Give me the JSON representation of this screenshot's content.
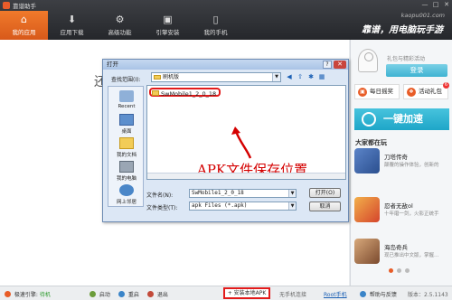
{
  "app": {
    "title": "靠谱助手"
  },
  "window_controls": [
    "—",
    "□",
    "✕"
  ],
  "nav": {
    "tabs": [
      {
        "label": "我的应用",
        "icon": "home-icon",
        "active": true
      },
      {
        "label": "应用下载",
        "icon": "download-icon",
        "active": false
      },
      {
        "label": "高级功能",
        "icon": "gears-icon",
        "active": false
      },
      {
        "label": "引擎安装",
        "icon": "engine-icon",
        "active": false
      },
      {
        "label": "我的手机",
        "icon": "phone-icon",
        "active": false
      }
    ],
    "brand_url": "kaopu001.com",
    "brand_slogan": "靠谱，用电脑玩手游"
  },
  "main": {
    "background_char": "还"
  },
  "side": {
    "hint": "礼包与精彩活动",
    "login_label": "登录",
    "daily_checkin": "每日摇奖",
    "gift_label": "活动礼包",
    "gift_badge": "6",
    "accelerate_label": "一键加速",
    "recommend_title": "大家都在玩",
    "games": [
      {
        "name": "刀塔传奇",
        "desc": "颠覆的操作体验，创新的"
      },
      {
        "name": "忍者无敌ol",
        "desc": "十年磨一剑，火影正统手"
      },
      {
        "name": "海岛奇兵",
        "desc": "现已推出中文版，掌握…"
      }
    ]
  },
  "dialog": {
    "title": "打开",
    "look_in_label": "查找范围(I):",
    "look_in_value": "刷机版",
    "places": [
      "Recent",
      "桌面",
      "我的文档",
      "我的电脑",
      "网上邻居"
    ],
    "file_item": "SwMobile1_2_0_18",
    "annotation": "APK文件保存位置",
    "filename_label": "文件名(N):",
    "filename_value": "SwMobile1_2_0_18",
    "filetype_label": "文件类型(T):",
    "filetype_value": "apk Files (*.apk)",
    "open_label": "打开(O)",
    "cancel_label": "取消"
  },
  "statusbar": {
    "engine_label": "极速引擎:",
    "engine_status": "待机",
    "start_label": "启动",
    "restart_label": "重启",
    "exit_label": "退出",
    "install_label": "安装本地APK",
    "phone_status": "无手机连接",
    "phone_link": "Root手机",
    "help_label": "帮助与反馈",
    "version": "版本：2.5.1143"
  },
  "colors": {
    "accent": "#e85c27",
    "highlight": "#e21b1b",
    "accelerate": "#28acd0"
  }
}
